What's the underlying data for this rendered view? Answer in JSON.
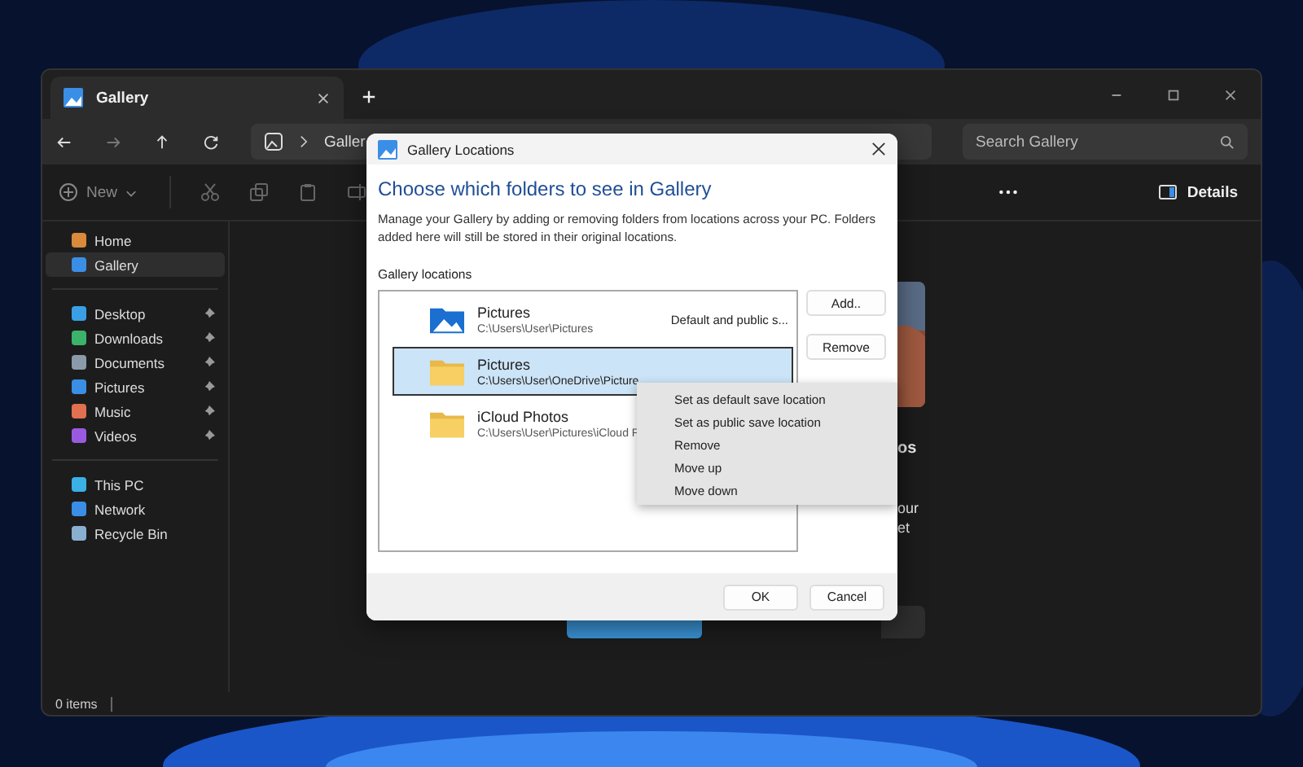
{
  "window": {
    "tab_title": "Gallery",
    "address": "Galler",
    "search": {
      "placeholder": "Search Gallery"
    }
  },
  "toolbar": {
    "new_label": "New",
    "details_label": "Details"
  },
  "sidebar": {
    "top": [
      {
        "label": "Home",
        "kind": "home",
        "selected": false
      },
      {
        "label": "Gallery",
        "kind": "gallery",
        "selected": true
      }
    ],
    "pinned": [
      {
        "label": "Desktop",
        "kind": "desktop",
        "pinned": true
      },
      {
        "label": "Downloads",
        "kind": "downloads",
        "pinned": true
      },
      {
        "label": "Documents",
        "kind": "documents",
        "pinned": true
      },
      {
        "label": "Pictures",
        "kind": "pictures",
        "pinned": true
      },
      {
        "label": "Music",
        "kind": "music",
        "pinned": true
      },
      {
        "label": "Videos",
        "kind": "videos",
        "pinned": true
      }
    ],
    "system": [
      {
        "label": "This PC",
        "kind": "pc"
      },
      {
        "label": "Network",
        "kind": "network"
      },
      {
        "label": "Recycle Bin",
        "kind": "bin"
      }
    ]
  },
  "content": {
    "fragments": [
      "os",
      "our",
      "et"
    ]
  },
  "status_bar": "0 items",
  "dialog": {
    "title": "Gallery Locations",
    "heading": "Choose which folders to see in Gallery",
    "description": "Manage your Gallery by adding or removing folders from locations across your PC. Folders added here will still be stored in their original locations.",
    "list_label": "Gallery locations",
    "locations": [
      {
        "name": "Pictures",
        "path": "C:\\Users\\User\\Pictures",
        "note": "Default and public s...",
        "kind": "pictures",
        "selected": false
      },
      {
        "name": "Pictures",
        "path": "C:\\Users\\User\\OneDrive\\Picture",
        "kind": "folder",
        "selected": true
      },
      {
        "name": "iCloud Photos",
        "path": "C:\\Users\\User\\Pictures\\iCloud F",
        "kind": "folder",
        "selected": false
      }
    ],
    "side_buttons": [
      "Add..",
      "Remove"
    ],
    "buttons": [
      "OK",
      "Cancel"
    ]
  },
  "context_menu": [
    "Set as default save location",
    "Set as public save location",
    "Remove",
    "Move up",
    "Move down"
  ]
}
